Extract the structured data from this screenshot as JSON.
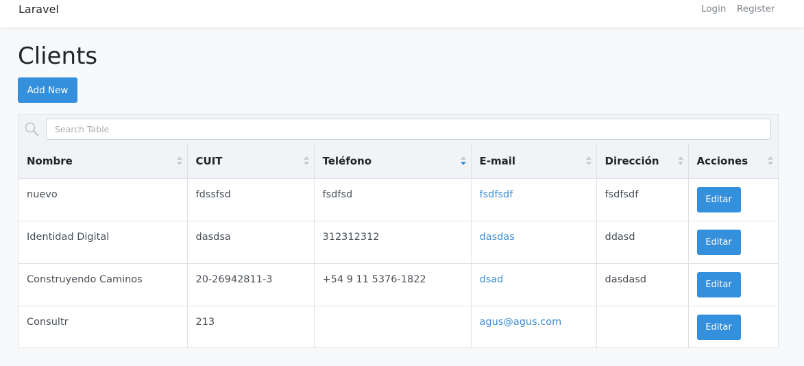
{
  "navbar": {
    "brand": "Laravel",
    "login": "Login",
    "register": "Register"
  },
  "page": {
    "title": "Clients",
    "add_button": "Add New"
  },
  "table": {
    "search_placeholder": "Search Table",
    "sorted_column": "Teléfono",
    "sort_direction": "descending",
    "columns": [
      "Nombre",
      "CUIT",
      "Teléfono",
      "E-mail",
      "Dirección",
      "Acciones"
    ],
    "rows": [
      {
        "nombre": "nuevo",
        "cuit": "fdssfsd",
        "telefono": "fsdfsd",
        "email": "fsdfsdf",
        "direccion": "fsdfsdf",
        "action": "Editar"
      },
      {
        "nombre": "Identidad Digital",
        "cuit": "dasdsa",
        "telefono": "312312312",
        "email": "dasdas",
        "direccion": "ddasd",
        "action": "Editar"
      },
      {
        "nombre": "Construyendo Caminos",
        "cuit": "20-26942811-3",
        "telefono": "+54 9 11 5376-1822",
        "email": "dsad",
        "direccion": "dasdasd",
        "action": "Editar"
      },
      {
        "nombre": "Consultr",
        "cuit": "213",
        "telefono": "",
        "email": "agus@agus.com",
        "direccion": "",
        "action": "Editar"
      }
    ]
  },
  "colors": {
    "primary": "#3490dc",
    "link": "#3c8ed6",
    "background": "#f8f9fb",
    "header_bg": "#f2f3f6"
  }
}
